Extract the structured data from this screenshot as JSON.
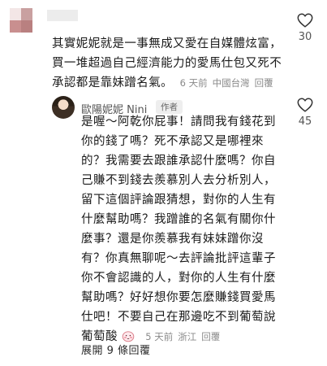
{
  "comment": {
    "text_lines": [
      "其實妮妮就是一事無成又愛在自媒體炫富，",
      "買一堆超過自己經濟能力的愛馬仕包又死不",
      "承認都是靠妹蹭名氣。"
    ],
    "time": "6 天前",
    "location": "中國台灣",
    "reply_label": "回覆",
    "likes": "30"
  },
  "reply": {
    "author_name": "歐陽妮妮 Nini",
    "author_badge": "作者",
    "likes": "45",
    "text_lines": [
      "是喔～阿乾你屁事！請問我有錢花到",
      "你的錢了嗎？死不承認又是哪裡來",
      "的？我需要去跟誰承認什麼嗎？你自",
      "己賺不到錢去羨慕別人去分析別人，",
      "留下這個評論跟猜想，對你的人生有",
      "什麼幫助嗎？我蹭誰的名氣有關你什",
      "麼事？還是你羨慕我有妹妹蹭你沒",
      "有？你真無聊呢～去評論批評這輩子",
      "你不會認識的人，對你的人生有什麼",
      "幫助嗎？好好想你要怎麼賺錢買愛馬",
      "仕吧！不要自己在那邊吃不到葡萄說",
      "葡萄酸"
    ],
    "emoji": "shy-face",
    "time": "5 天前",
    "location": "浙江",
    "reply_label": "回覆"
  },
  "expand_replies": "展開 9 條回覆",
  "colors": {
    "heart_outline": "#333333",
    "meta_text": "#8a8a8a"
  }
}
